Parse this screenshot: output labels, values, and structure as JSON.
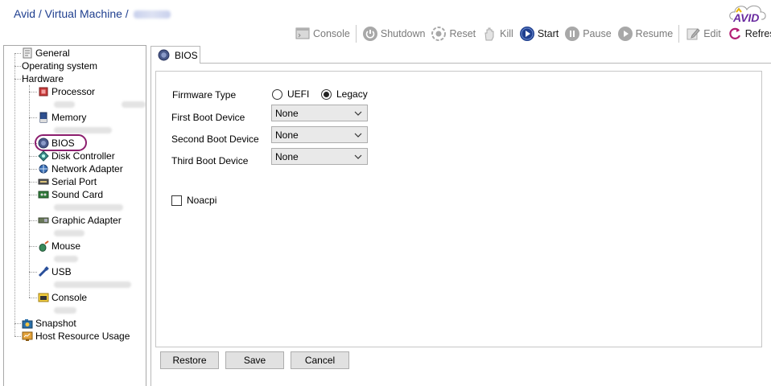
{
  "header": {
    "breadcrumb": "Avid / Virtual Machine /",
    "logo_text": "AVID"
  },
  "toolbar": {
    "items": [
      {
        "label": "Console",
        "icon": "console-icon"
      },
      {
        "label": "Shutdown",
        "icon": "power-icon"
      },
      {
        "label": "Reset",
        "icon": "reset-icon"
      },
      {
        "label": "Kill",
        "icon": "hand-icon"
      },
      {
        "label": "Start",
        "icon": "play-icon",
        "enabled": true
      },
      {
        "label": "Pause",
        "icon": "pause-icon"
      },
      {
        "label": "Resume",
        "icon": "resume-icon"
      },
      {
        "label": "Edit",
        "icon": "edit-icon"
      },
      {
        "label": "Refresh",
        "icon": "refresh-icon",
        "enabled": true
      }
    ]
  },
  "tree": {
    "general": "General",
    "os": "Operating system",
    "hardware": "Hardware",
    "processor": "Processor",
    "memory": "Memory",
    "bios": "BIOS",
    "disk": "Disk Controller",
    "network": "Network Adapter",
    "serial": "Serial Port",
    "sound": "Sound Card",
    "graphic": "Graphic Adapter",
    "mouse": "Mouse",
    "usb": "USB",
    "console": "Console",
    "snapshot": "Snapshot",
    "host": "Host Resource Usage",
    "selected": "BIOS"
  },
  "tab": {
    "label": "BIOS"
  },
  "form": {
    "firmware_label": "Firmware Type",
    "firmware_options": [
      "UEFI",
      "Legacy"
    ],
    "firmware_selected": "Legacy",
    "first_boot_label": "First Boot Device",
    "first_boot_value": "None",
    "second_boot_label": "Second Boot Device",
    "second_boot_value": "None",
    "third_boot_label": "Third Boot Device",
    "third_boot_value": "None",
    "noacpi_label": "Noacpi",
    "noacpi_checked": false
  },
  "buttons": {
    "restore": "Restore",
    "save": "Save",
    "cancel": "Cancel"
  },
  "colors": {
    "accent": "#1f3f8f",
    "highlight": "#8c1e6e",
    "logo": "#6a2ca0",
    "logo_accent": "#e8b400"
  }
}
